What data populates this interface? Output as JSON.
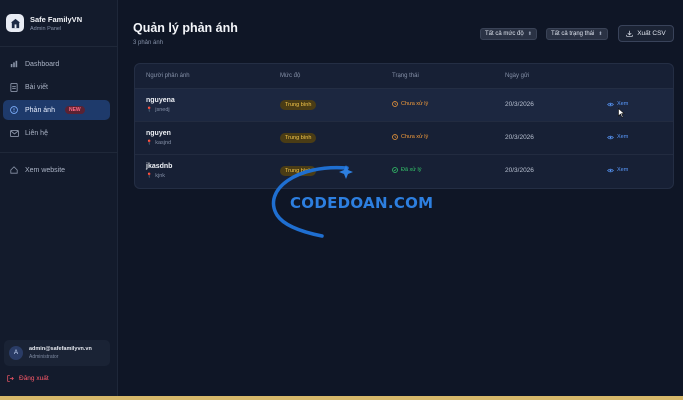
{
  "brand": {
    "name": "Safe FamilyVN",
    "subtitle": "Admin Panel"
  },
  "nav": [
    {
      "label": "Dashboard",
      "icon": "bar-chart-icon"
    },
    {
      "label": "Bài viết",
      "icon": "document-icon"
    },
    {
      "label": "Phản ánh",
      "icon": "alert-circle-icon",
      "badge": "NEW",
      "active": true
    },
    {
      "label": "Liên hệ",
      "icon": "mail-icon"
    }
  ],
  "view_site": {
    "label": "Xem website",
    "icon": "home-icon"
  },
  "user": {
    "avatar": "A",
    "email": "admin@safefamilyvn.vn",
    "role": "Administrator"
  },
  "logout": {
    "label": "Đăng xuất",
    "icon": "logout-icon"
  },
  "page": {
    "title": "Quản lý phản ánh",
    "subtitle": "3 phản ánh"
  },
  "filters": {
    "level": "Tất cả mức độ",
    "status": "Tất cả trạng thái"
  },
  "export": {
    "label": "Xuất CSV",
    "icon": "download-icon"
  },
  "table": {
    "headers": [
      "Người phản ánh",
      "Mức độ",
      "Trạng thái",
      "Ngày gửi"
    ],
    "rows": [
      {
        "name": "nguyena",
        "location": "jsnedj",
        "level": "Trung bình",
        "status": "Chưa xử lý",
        "status_type": "pending",
        "date": "20/3/2026",
        "action": "Xem"
      },
      {
        "name": "nguyen",
        "location": "kasjnd",
        "level": "Trung bình",
        "status": "Chưa xử lý",
        "status_type": "pending",
        "date": "20/3/2026",
        "action": "Xem"
      },
      {
        "name": "jkasdnb",
        "location": "kjnk",
        "level": "Trung bình",
        "status": "Đã xử lý",
        "status_type": "done",
        "date": "20/3/2026",
        "action": "Xem"
      }
    ]
  },
  "watermark": {
    "text": "CODEDOAN.COM"
  },
  "colors": {
    "accent": "#5a9bff",
    "pending": "#f59d3b",
    "done": "#34c76b",
    "level_badge": "#f3c64a",
    "danger": "#ff5a6a"
  }
}
